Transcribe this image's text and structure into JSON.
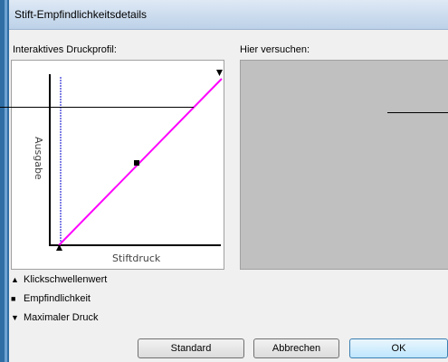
{
  "window": {
    "title": "Stift-Empfindlichkeitsdetails"
  },
  "profile": {
    "label": "Interaktives Druckprofil:",
    "y_axis_label": "Ausgabe",
    "x_axis_label": "Stiftdruck"
  },
  "try_area": {
    "label": "Hier versuchen:"
  },
  "legend": [
    {
      "symbol": "▲",
      "label": "Klickschwellenwert"
    },
    {
      "symbol": "■",
      "label": "Empfindlichkeit"
    },
    {
      "symbol": "▼",
      "label": "Maximaler Druck"
    }
  ],
  "buttons": {
    "standard": "Standard",
    "cancel": "Abbrechen",
    "ok": "OK"
  },
  "colors": {
    "curve": "#ff00ff",
    "threshold_line": "#0000cc"
  }
}
